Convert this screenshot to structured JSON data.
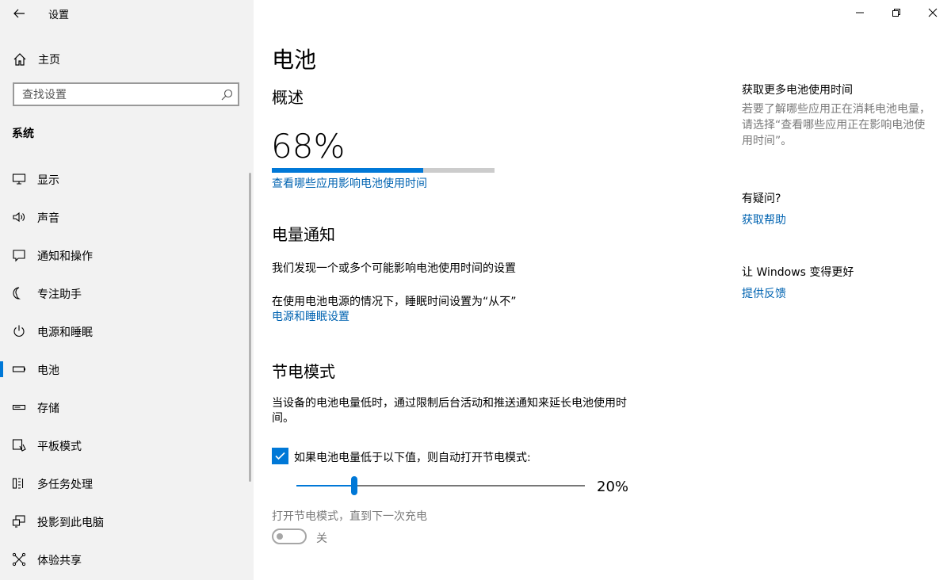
{
  "window": {
    "title": "设置",
    "controls": {
      "minimize": "minimize-icon",
      "maximize": "restore-icon",
      "close": "close-icon"
    }
  },
  "sidebar": {
    "home_label": "主页",
    "search_placeholder": "查找设置",
    "section_title": "系统",
    "items": [
      {
        "label": "显示",
        "icon": "display-icon",
        "active": false
      },
      {
        "label": "声音",
        "icon": "sound-icon",
        "active": false
      },
      {
        "label": "通知和操作",
        "icon": "notification-icon",
        "active": false
      },
      {
        "label": "专注助手",
        "icon": "moon-icon",
        "active": false
      },
      {
        "label": "电源和睡眠",
        "icon": "power-icon",
        "active": false
      },
      {
        "label": "电池",
        "icon": "battery-icon",
        "active": true
      },
      {
        "label": "存储",
        "icon": "storage-icon",
        "active": false
      },
      {
        "label": "平板模式",
        "icon": "tablet-mode-icon",
        "active": false
      },
      {
        "label": "多任务处理",
        "icon": "multitasking-icon",
        "active": false
      },
      {
        "label": "投影到此电脑",
        "icon": "projecting-icon",
        "active": false
      },
      {
        "label": "体验共享",
        "icon": "shared-experiences-icon",
        "active": false
      }
    ]
  },
  "main": {
    "page_title": "电池",
    "overview": {
      "heading": "概述",
      "percent_text": "68%",
      "battery_level": 0.68,
      "link": "查看哪些应用影响电池使用时间"
    },
    "notifications": {
      "heading": "电量通知",
      "line1": "我们发现一个或多个可能影响电池使用时间的设置",
      "line2": "在使用电池电源的情况下，睡眠时间设置为“从不”",
      "link": "电源和睡眠设置"
    },
    "saver": {
      "heading": "节电模式",
      "description": "当设备的电池电量低时，通过限制后台活动和推送通知来延长电池使用时间。",
      "checkbox_label": "如果电池电量低于以下值，则自动打开节电模式:",
      "checkbox_checked": true,
      "slider_value_text": "20%",
      "slider_value": 0.2,
      "toggle_caption": "打开节电模式，直到下一次充电",
      "toggle_state": "关",
      "toggle_on": false
    }
  },
  "right_panel": {
    "more_title": "获取更多电池使用时间",
    "more_text": "若要了解哪些应用正在消耗电池电量，请选择“查看哪些应用正在影响电池使用时间”。",
    "question_title": "有疑问?",
    "help_link": "获取帮助",
    "improve_title": "让 Windows 变得更好",
    "feedback_link": "提供反馈"
  },
  "colors": {
    "accent": "#0078d7",
    "link": "#0063b1",
    "sidebar_bg": "#f2f2f2"
  }
}
